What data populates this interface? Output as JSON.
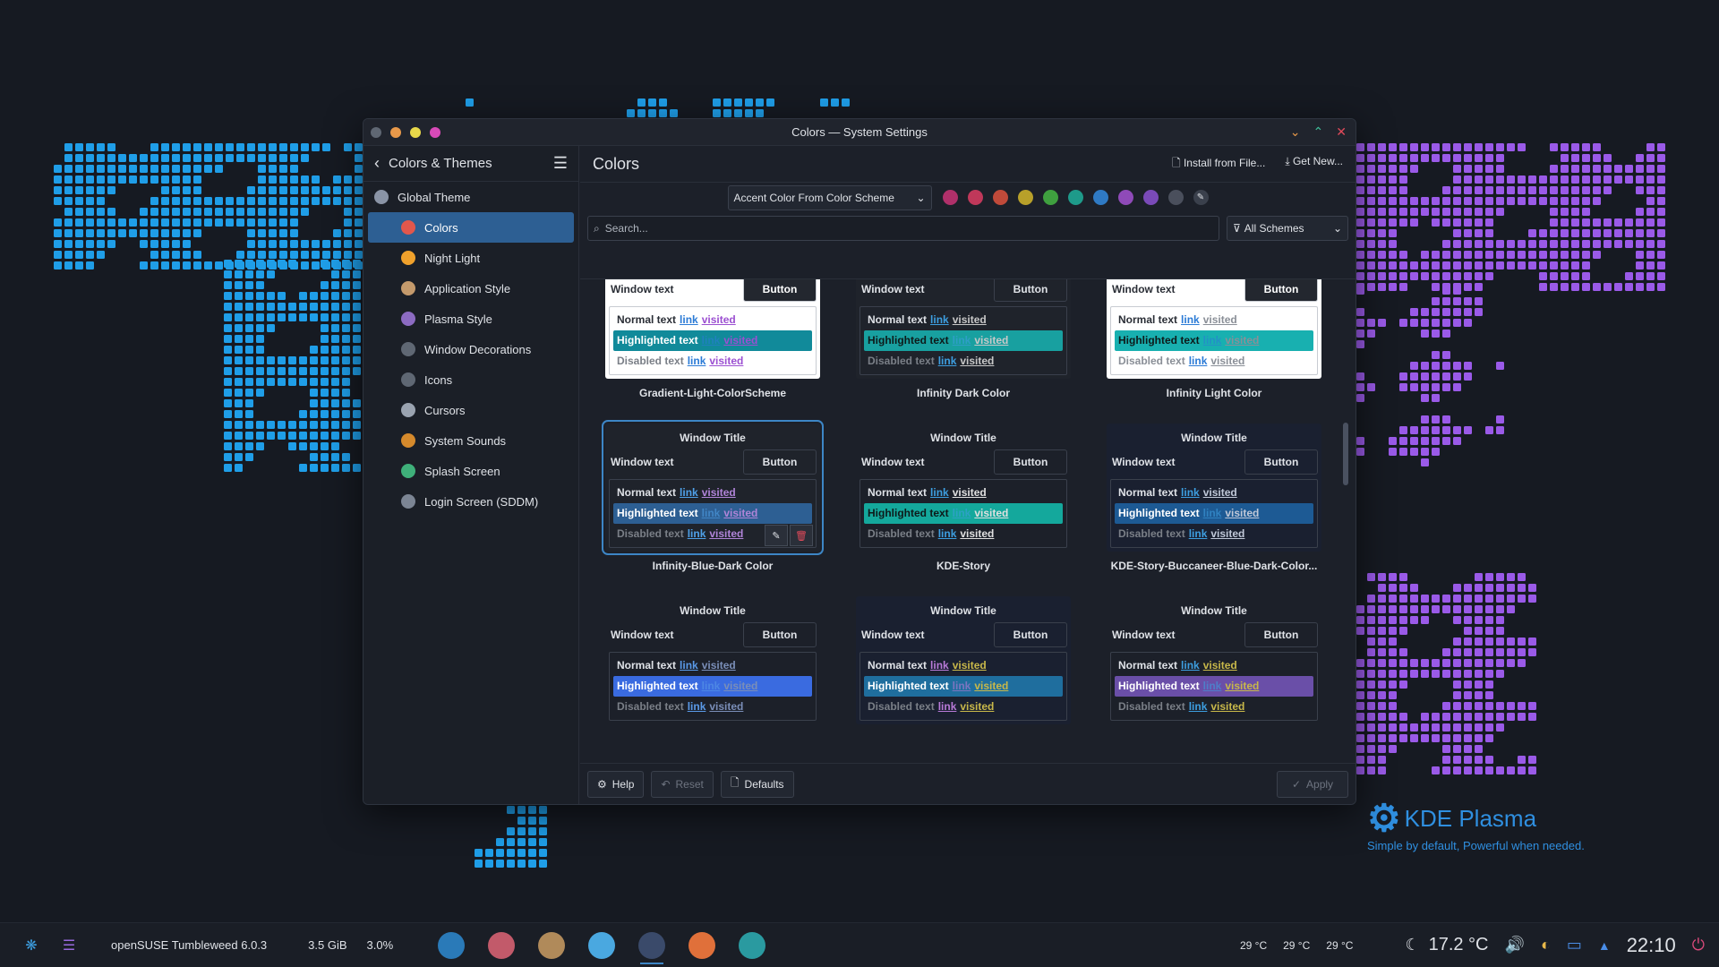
{
  "window": {
    "title": "Colors — System Settings",
    "controls": [
      "⌄",
      "⌃",
      "✕"
    ]
  },
  "sidebar": {
    "back_icon": "back-arrow-icon",
    "title": "Colors & Themes",
    "menu_icon": "hamburger-icon",
    "items": [
      {
        "label": "Global Theme",
        "icon": "global-theme-icon",
        "color": "#8a94a6"
      },
      {
        "label": "Colors",
        "icon": "colors-icon",
        "color": "#e2574c"
      },
      {
        "label": "Night Light",
        "icon": "night-light-icon",
        "color": "#f0a12c"
      },
      {
        "label": "Application Style",
        "icon": "application-style-icon",
        "color": "#c49a6c"
      },
      {
        "label": "Plasma Style",
        "icon": "plasma-style-icon",
        "color": "#8c6bc2"
      },
      {
        "label": "Window Decorations",
        "icon": "window-decorations-icon",
        "color": "#5f6773"
      },
      {
        "label": "Icons",
        "icon": "icons-icon",
        "color": "#5f6773"
      },
      {
        "label": "Cursors",
        "icon": "cursors-icon",
        "color": "#9aa3b0"
      },
      {
        "label": "System Sounds",
        "icon": "system-sounds-icon",
        "color": "#d68a2c"
      },
      {
        "label": "Splash Screen",
        "icon": "splash-screen-icon",
        "color": "#3fb07a"
      },
      {
        "label": "Login Screen (SDDM)",
        "icon": "login-screen-icon",
        "color": "#7c8594"
      }
    ]
  },
  "main": {
    "title": "Colors",
    "install_label": "Install from File...",
    "get_new_label": "Get New...",
    "accent_select": "Accent Color From Color Scheme",
    "accent_colors": [
      "#b0306a",
      "#c0385a",
      "#c04a3a",
      "#b8a02a",
      "#3fa03f",
      "#1e9a8a",
      "#2f7ac4",
      "#8f4ab8",
      "#7a4ab8",
      "#4a4f5c"
    ],
    "search_placeholder": "Search...",
    "filter_label": "All Schemes",
    "help_label": "Help",
    "reset_label": "Reset",
    "defaults_label": "Defaults",
    "apply_label": "Apply"
  },
  "preview_strings": {
    "window_title": "Window Title",
    "window_text": "Window text",
    "button": "Button",
    "normal": "Normal text",
    "highlighted": "Highlighted text",
    "disabled": "Disabled text",
    "link": "link",
    "visited": "visited"
  },
  "schemes": [
    {
      "name": "Gradient-Light-ColorScheme",
      "show_title": false,
      "bg": "#ffffff",
      "fg": "#2a2e36",
      "btn_bg": "#23272f",
      "btn_fg": "#ffffff",
      "view_bg": "#ffffff",
      "view_border": "#c8ccd2",
      "hl": "#118a9a",
      "hl_fg": "#ffffff",
      "link": "#2b7bd6",
      "visited": "#9b4fd1",
      "dis": "#7a7f87"
    },
    {
      "name": "Infinity Dark Color",
      "show_title": false,
      "bg": "#1f232b",
      "fg": "#dfe2e7",
      "btn_bg": "#1f232b",
      "btn_fg": "#dfe2e7",
      "view_bg": "#1f232b",
      "view_border": "#3a404c",
      "hl": "#18a0a0",
      "hl_fg": "#0e1a1a",
      "link": "#3d9ee0",
      "visited": "#c8c8c8",
      "dis": "#7a7f87"
    },
    {
      "name": "Infinity Light Color",
      "show_title": false,
      "bg": "#ffffff",
      "fg": "#2a2e36",
      "btn_bg": "#23272f",
      "btn_fg": "#ffffff",
      "view_bg": "#ffffff",
      "view_border": "#c8ccd2",
      "hl": "#18b0b0",
      "hl_fg": "#0e1a1a",
      "link": "#2b7bd6",
      "visited": "#8a8f97",
      "dis": "#8a8f97"
    },
    {
      "name": "Infinity-Blue-Dark Color",
      "show_title": true,
      "selected": true,
      "bg": "#1f232b",
      "fg": "#dfe2e7",
      "btn_bg": "#1f232b",
      "btn_fg": "#dfe2e7",
      "view_bg": "#1f232b",
      "view_border": "#3a404c",
      "hl": "#2d5f93",
      "hl_fg": "#ffffff",
      "link": "#4fa0e8",
      "visited": "#b084d8",
      "dis": "#7a7f87"
    },
    {
      "name": "KDE-Story",
      "show_title": true,
      "bg": "#1c2029",
      "fg": "#dfe2e7",
      "btn_bg": "#1c2029",
      "btn_fg": "#dfe2e7",
      "view_bg": "#1c2029",
      "view_border": "#3a404c",
      "hl": "#14a89c",
      "hl_fg": "#0e1a1a",
      "link": "#3d9ee0",
      "visited": "#e0e0e0",
      "dis": "#7a7f87"
    },
    {
      "name": "KDE-Story-Buccaneer-Blue-Dark-Color...",
      "show_title": true,
      "bg": "#1a2030",
      "fg": "#dfe2e7",
      "btn_bg": "#1a2030",
      "btn_fg": "#dfe2e7",
      "view_bg": "#1a2030",
      "view_border": "#3a404c",
      "hl": "#1d5a94",
      "hl_fg": "#ffffff",
      "link": "#3d9ee0",
      "visited": "#c0c8d8",
      "dis": "#7a7f87"
    },
    {
      "name": "",
      "show_title": true,
      "bg": "#1c2029",
      "fg": "#dfe2e7",
      "btn_bg": "#1c2029",
      "btn_fg": "#dfe2e7",
      "view_bg": "#1c2029",
      "view_border": "#3a404c",
      "hl": "#3a6be0",
      "hl_fg": "#ffffff",
      "link": "#5a9ae8",
      "visited": "#7a8eb8",
      "dis": "#7a7f87"
    },
    {
      "name": "",
      "show_title": true,
      "bg": "#1a2030",
      "fg": "#dfe2e7",
      "btn_bg": "#1a2030",
      "btn_fg": "#dfe2e7",
      "view_bg": "#1a2030",
      "view_border": "#3a404c",
      "hl": "#1f6e9e",
      "hl_fg": "#ffffff",
      "link": "#b87ad8",
      "visited": "#c8b84a",
      "dis": "#7a7f87"
    },
    {
      "name": "",
      "show_title": true,
      "bg": "#1c2029",
      "fg": "#dfe2e7",
      "btn_bg": "#1c2029",
      "btn_fg": "#dfe2e7",
      "view_bg": "#1c2029",
      "view_border": "#3a404c",
      "hl": "#6a4fa8",
      "hl_fg": "#ffffff",
      "link": "#3d9ee0",
      "visited": "#c8b84a",
      "dis": "#7a7f87"
    }
  ],
  "wallpaper": {
    "brand_name": "KDE Plasma",
    "tagline": "Simple by default, Powerful when  needed."
  },
  "taskbar": {
    "system_name": "openSUSE Tumbleweed 6.0.3",
    "memory": "3.5 GiB",
    "cpu": "3.0%",
    "apps": [
      {
        "icon": "system-monitor-icon",
        "color": "#2a7ab8"
      },
      {
        "icon": "discover-icon",
        "color": "#c25a6a"
      },
      {
        "icon": "gimp-icon",
        "color": "#b08a5a"
      },
      {
        "icon": "krita-icon",
        "color": "#4aa8e0"
      },
      {
        "icon": "system-settings-icon",
        "color": "#3a4a6a"
      },
      {
        "icon": "firefox-icon",
        "color": "#e0703a"
      },
      {
        "icon": "file-manager-icon",
        "color": "#2a9aa0"
      }
    ],
    "temps": [
      "29 °C",
      "29 °C",
      "29 °C"
    ],
    "weather": "17.2 °C",
    "clock": "22:10"
  }
}
